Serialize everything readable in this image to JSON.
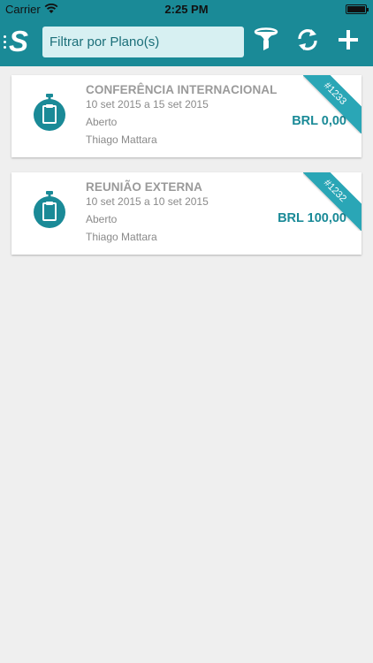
{
  "status_bar": {
    "carrier": "Carrier",
    "time": "2:25 PM"
  },
  "header": {
    "logo": "S",
    "search_placeholder": "Filtrar por Plano(s)",
    "icons": [
      "menu-icon",
      "filter-icon",
      "sync-icon",
      "add-icon"
    ]
  },
  "colors": {
    "primary": "#1a8a97",
    "ribbon": "#2aa6b6",
    "background": "#efefef"
  },
  "plans": [
    {
      "title": "CONFERÊNCIA INTERNACIONAL",
      "dates": "10 set 2015 a 15 set 2015",
      "status": "Aberto",
      "owner": "Thiago Mattara",
      "amount": "BRL 0,00",
      "id": "#1233"
    },
    {
      "title": "REUNIÃO EXTERNA",
      "dates": "10 set 2015 a 10 set 2015",
      "status": "Aberto",
      "owner": "Thiago Mattara",
      "amount": "BRL 100,00",
      "id": "#1232"
    }
  ]
}
